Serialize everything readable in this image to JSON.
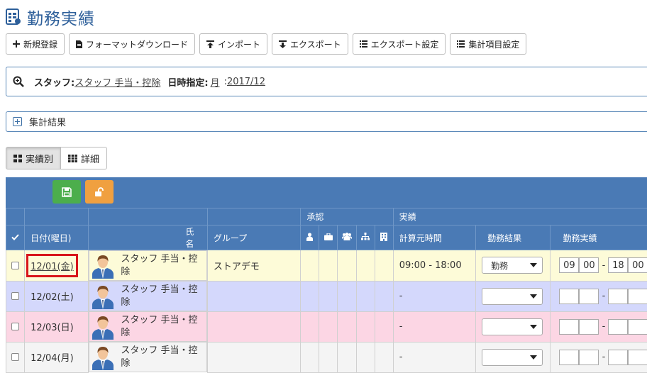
{
  "page": {
    "title": "勤務実績"
  },
  "toolbar": {
    "buttons": [
      {
        "label": "新規登録",
        "icon": "plus-icon"
      },
      {
        "label": "フォーマットダウンロード",
        "icon": "file-icon"
      },
      {
        "label": "インポート",
        "icon": "import-icon"
      },
      {
        "label": "エクスポート",
        "icon": "export-icon"
      },
      {
        "label": "エクスポート設定",
        "icon": "list-icon"
      },
      {
        "label": "集計項目設定",
        "icon": "list-icon"
      }
    ]
  },
  "search": {
    "staff_label": "スタッフ:",
    "staff_value": "スタッフ 手当・控除",
    "date_label": "日時指定:",
    "period_value": "月",
    "separator": ":",
    "month_value": "2017/12"
  },
  "summary": {
    "label": "集計結果"
  },
  "view_toggle": {
    "by_record": "実績別",
    "detail": "詳細"
  },
  "grid": {
    "group_headers": {
      "approval": "承認",
      "actual": "実績"
    },
    "headers": {
      "date": "日付(曜日)",
      "name": "氏名",
      "group": "グループ",
      "calc_time": "計算元時間",
      "work_result": "勤務結果",
      "work_actual": "勤務実績"
    },
    "approval_icons": [
      "person-icon",
      "briefcase-icon",
      "group-icon",
      "org-chart-icon",
      "building-icon"
    ],
    "rows": [
      {
        "date": "12/01(金)",
        "name": "スタッフ 手当・控除",
        "group": "ストアデモ",
        "calc_time": "09:00 - 18:00",
        "work_result": "勤務",
        "start_h": "09",
        "start_m": "00",
        "end_h": "18",
        "end_m": "00"
      },
      {
        "date": "12/02(土)",
        "name": "スタッフ 手当・控除",
        "group": "",
        "calc_time": "-",
        "work_result": "",
        "start_h": "",
        "start_m": "",
        "end_h": "",
        "end_m": ""
      },
      {
        "date": "12/03(日)",
        "name": "スタッフ 手当・控除",
        "group": "",
        "calc_time": "-",
        "work_result": "",
        "start_h": "",
        "start_m": "",
        "end_h": "",
        "end_m": ""
      },
      {
        "date": "12/04(月)",
        "name": "スタッフ 手当・控除",
        "group": "",
        "calc_time": "-",
        "work_result": "",
        "start_h": "",
        "start_m": "",
        "end_h": "",
        "end_m": ""
      }
    ]
  },
  "colors": {
    "header_blue": "#4a7ab5",
    "save_green": "#4cae4c",
    "unlock_orange": "#f0a040",
    "highlight_red": "#d8151b",
    "friday_row": "#fdfbd8",
    "saturday_row": "#d4d8fc",
    "sunday_row": "#fcd6e4"
  }
}
